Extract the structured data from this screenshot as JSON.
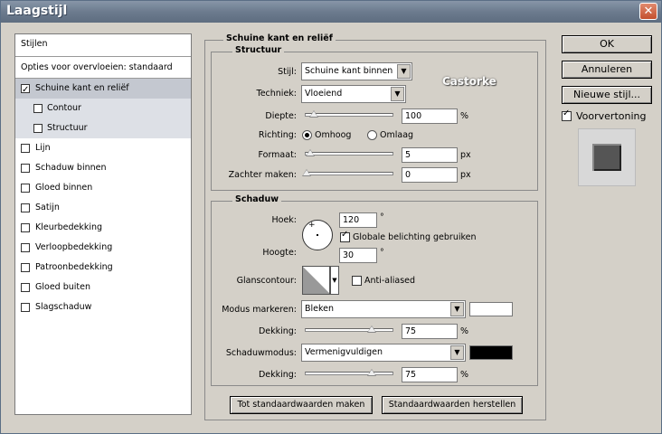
{
  "window": {
    "title": "Laagstijl"
  },
  "styles_list": {
    "header": "Stijlen",
    "blend_options": "Opties voor overvloeien: standaard",
    "items": [
      {
        "label": "Schuine kant en reliëf",
        "checked": true
      },
      {
        "label": "Contour",
        "checked": false
      },
      {
        "label": "Structuur",
        "checked": false
      },
      {
        "label": "Lijn",
        "checked": false
      },
      {
        "label": "Schaduw binnen",
        "checked": false
      },
      {
        "label": "Gloed binnen",
        "checked": false
      },
      {
        "label": "Satijn",
        "checked": false
      },
      {
        "label": "Kleurbedekking",
        "checked": false
      },
      {
        "label": "Verloopbedekking",
        "checked": false
      },
      {
        "label": "Patroonbedekking",
        "checked": false
      },
      {
        "label": "Gloed buiten",
        "checked": false
      },
      {
        "label": "Slagschaduw",
        "checked": false
      }
    ]
  },
  "panel": {
    "title": "Schuine kant en reliëf",
    "structure": {
      "title": "Structuur",
      "style_label": "Stijl:",
      "style_value": "Schuine kant binnen",
      "technique_label": "Techniek:",
      "technique_value": "Vloeiend",
      "depth_label": "Diepte:",
      "depth_value": "100",
      "depth_unit": "%",
      "direction_label": "Richting:",
      "direction_up": "Omhoog",
      "direction_down": "Omlaag",
      "size_label": "Formaat:",
      "size_value": "5",
      "size_unit": "px",
      "soften_label": "Zachter maken:",
      "soften_value": "0",
      "soften_unit": "px",
      "watermark": "Castorke"
    },
    "shading": {
      "title": "Schaduw",
      "angle_label": "Hoek:",
      "angle_value": "120",
      "angle_unit": "°",
      "global_light": "Globale belichting gebruiken",
      "altitude_label": "Hoogte:",
      "altitude_value": "30",
      "altitude_unit": "°",
      "gloss_label": "Glanscontour:",
      "anti_aliased": "Anti-aliased",
      "highlight_mode_label": "Modus markeren:",
      "highlight_mode_value": "Bleken",
      "highlight_color": "#ffffff",
      "highlight_opacity_label": "Dekking:",
      "highlight_opacity_value": "75",
      "highlight_opacity_unit": "%",
      "shadow_mode_label": "Schaduwmodus:",
      "shadow_mode_value": "Vermenigvuldigen",
      "shadow_color": "#000000",
      "shadow_opacity_label": "Dekking:",
      "shadow_opacity_value": "75",
      "shadow_opacity_unit": "%"
    },
    "make_default": "Tot standaardwaarden maken",
    "reset_default": "Standaardwaarden herstellen"
  },
  "buttons": {
    "ok": "OK",
    "cancel": "Annuleren",
    "new_style": "Nieuwe stijl...",
    "preview": "Voorvertoning"
  }
}
